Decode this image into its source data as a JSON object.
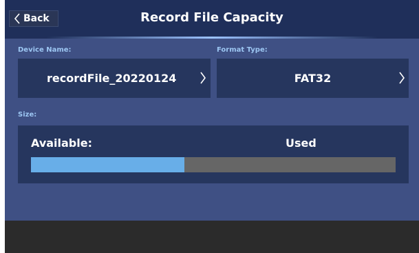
{
  "header": {
    "back_label": "Back",
    "title": "Record File Capacity"
  },
  "device": {
    "label": "Device Name:",
    "value": "recordFile_20220124"
  },
  "format": {
    "label": "Format Type:",
    "value": "FAT32"
  },
  "size": {
    "label": "Size:",
    "available_label": "Available:",
    "used_label": "Used",
    "used_fraction": 0.42
  },
  "colors": {
    "background": "#3f5084",
    "header": "#1f2f5a",
    "panel": "#26365e",
    "label": "#9cc6f2",
    "bar_fill": "#68aee8",
    "bar_track": "#666666",
    "footer": "#2b2b2b"
  },
  "icons": {
    "back": "chevron-left-icon",
    "select": "chevron-right-icon"
  }
}
